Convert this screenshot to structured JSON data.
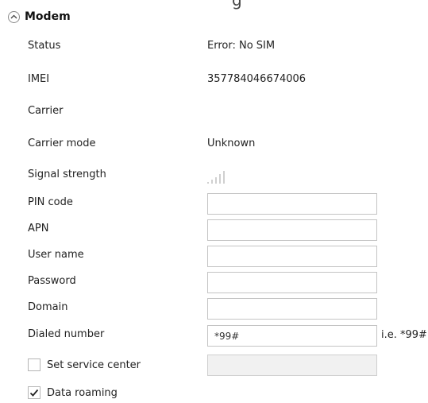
{
  "section": {
    "title": "Modem"
  },
  "status": {
    "label": "Status",
    "value": "Error: No SIM"
  },
  "imei": {
    "label": "IMEI",
    "value": "357784046674006"
  },
  "carrier": {
    "label": "Carrier",
    "value": ""
  },
  "carrier_mode": {
    "label": "Carrier mode",
    "value": "Unknown"
  },
  "signal": {
    "label": "Signal strength",
    "bars": 0,
    "icon": "signal-bars-icon"
  },
  "pin_code": {
    "label": "PIN code",
    "value": ""
  },
  "apn": {
    "label": "APN",
    "value": ""
  },
  "user_name": {
    "label": "User name",
    "value": ""
  },
  "password": {
    "label": "Password",
    "value": ""
  },
  "domain": {
    "label": "Domain",
    "value": ""
  },
  "dialed_number": {
    "label": "Dialed number",
    "value": "*99#",
    "hint": "i.e. *99#"
  },
  "service_center": {
    "label": "Set service center",
    "checked": false,
    "value": ""
  },
  "data_roaming": {
    "label": "Data roaming",
    "checked": true
  }
}
